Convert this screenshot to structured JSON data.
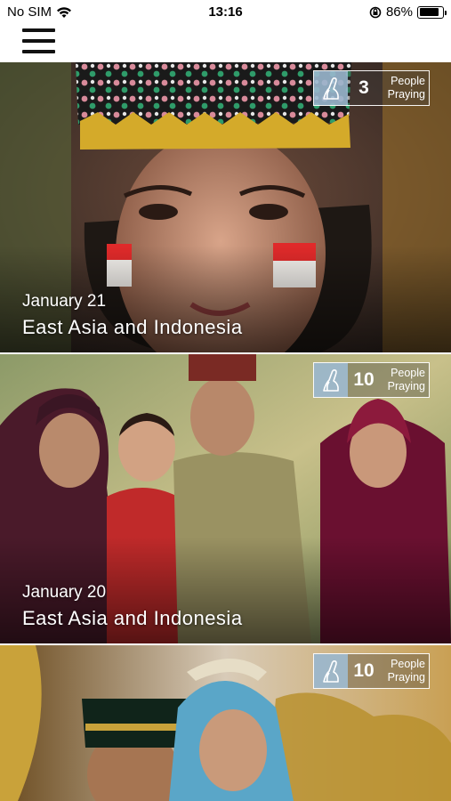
{
  "status_bar": {
    "carrier": "No SIM",
    "time": "13:16",
    "battery_percent": "86%",
    "battery_level": 0.86
  },
  "nav": {
    "menu_icon": "hamburger-menu-icon"
  },
  "cards": [
    {
      "date": "January 21",
      "title": "East Asia and Indonesia",
      "prayer_count": "3",
      "prayer_label_line1": "People",
      "prayer_label_line2": "Praying",
      "icon": "praying-hands-icon"
    },
    {
      "date": "January 20",
      "title": "East Asia and Indonesia",
      "prayer_count": "10",
      "prayer_label_line1": "People",
      "prayer_label_line2": "Praying",
      "icon": "praying-hands-icon"
    },
    {
      "date": "",
      "title": "",
      "prayer_count": "10",
      "prayer_label_line1": "People",
      "prayer_label_line2": "Praying",
      "icon": "praying-hands-icon"
    }
  ],
  "colors": {
    "badge_icon_bg": "#a0bed7",
    "text_light": "#ffffff"
  }
}
